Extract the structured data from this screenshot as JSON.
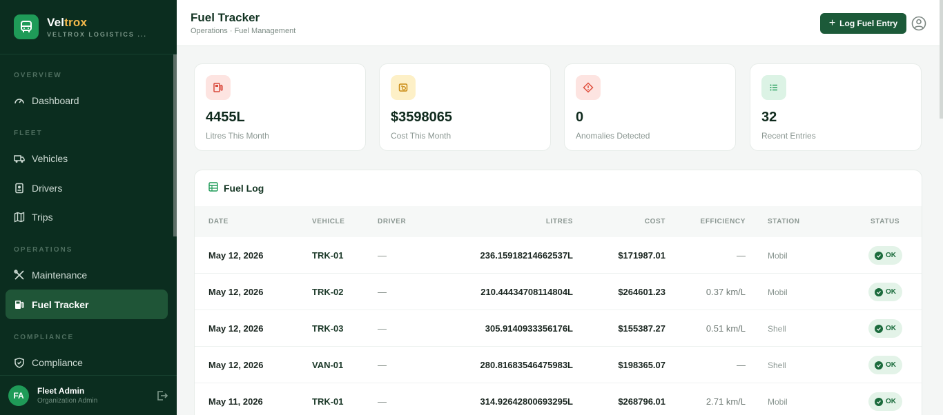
{
  "brand": {
    "name_main": "Vel",
    "name_accent": "trox",
    "subtitle": "VELTROX LOGISTICS ..."
  },
  "sidebar": {
    "sections": [
      "OVERVIEW",
      "FLEET",
      "OPERATIONS",
      "COMPLIANCE"
    ],
    "items": [
      {
        "label": "Dashboard",
        "icon": "gauge-icon"
      },
      {
        "label": "Vehicles",
        "icon": "truck-icon"
      },
      {
        "label": "Drivers",
        "icon": "id-card-icon"
      },
      {
        "label": "Trips",
        "icon": "map-icon"
      },
      {
        "label": "Maintenance",
        "icon": "tools-icon"
      },
      {
        "label": "Fuel Tracker",
        "icon": "fuel-pump-icon",
        "active": true
      },
      {
        "label": "Compliance",
        "icon": "shield-icon"
      }
    ]
  },
  "user": {
    "initials": "FA",
    "name": "Fleet Admin",
    "role": "Organization Admin"
  },
  "header": {
    "title": "Fuel Tracker",
    "breadcrumb": "Operations · Fuel Management",
    "primary_button": "Log Fuel Entry"
  },
  "stats": [
    {
      "value": "4455L",
      "label": "Litres This Month",
      "icon": "fuel-pump-icon",
      "color": "#d9483b",
      "bg": "#fde4e1"
    },
    {
      "value": "$3598065",
      "label": "Cost This Month",
      "icon": "receipt-icon",
      "color": "#c98a12",
      "bg": "#fdf0c7"
    },
    {
      "value": "0",
      "label": "Anomalies Detected",
      "icon": "warning-diamond-icon",
      "color": "#e0503f",
      "bg": "#fde4e1"
    },
    {
      "value": "32",
      "label": "Recent Entries",
      "icon": "list-icon",
      "color": "#1f9b58",
      "bg": "#dcf3e5"
    }
  ],
  "fuel_log": {
    "title": "Fuel Log",
    "columns": [
      "DATE",
      "VEHICLE",
      "DRIVER",
      "LITRES",
      "COST",
      "EFFICIENCY",
      "STATION",
      "STATUS"
    ],
    "rows": [
      {
        "date": "May 12, 2026",
        "vehicle": "TRK-01",
        "driver": "—",
        "litres": "236.15918214662537L",
        "cost": "$171987.01",
        "efficiency": "—",
        "station": "Mobil",
        "status": "OK"
      },
      {
        "date": "May 12, 2026",
        "vehicle": "TRK-02",
        "driver": "—",
        "litres": "210.44434708114804L",
        "cost": "$264601.23",
        "efficiency": "0.37 km/L",
        "station": "Mobil",
        "status": "OK"
      },
      {
        "date": "May 12, 2026",
        "vehicle": "TRK-03",
        "driver": "—",
        "litres": "305.9140933356176L",
        "cost": "$155387.27",
        "efficiency": "0.51 km/L",
        "station": "Shell",
        "status": "OK"
      },
      {
        "date": "May 12, 2026",
        "vehicle": "VAN-01",
        "driver": "—",
        "litres": "280.81683546475983L",
        "cost": "$198365.07",
        "efficiency": "—",
        "station": "Shell",
        "status": "OK"
      },
      {
        "date": "May 11, 2026",
        "vehicle": "TRK-01",
        "driver": "—",
        "litres": "314.92642800693295L",
        "cost": "$268796.01",
        "efficiency": "2.71 km/L",
        "station": "Mobil",
        "status": "OK"
      }
    ]
  }
}
